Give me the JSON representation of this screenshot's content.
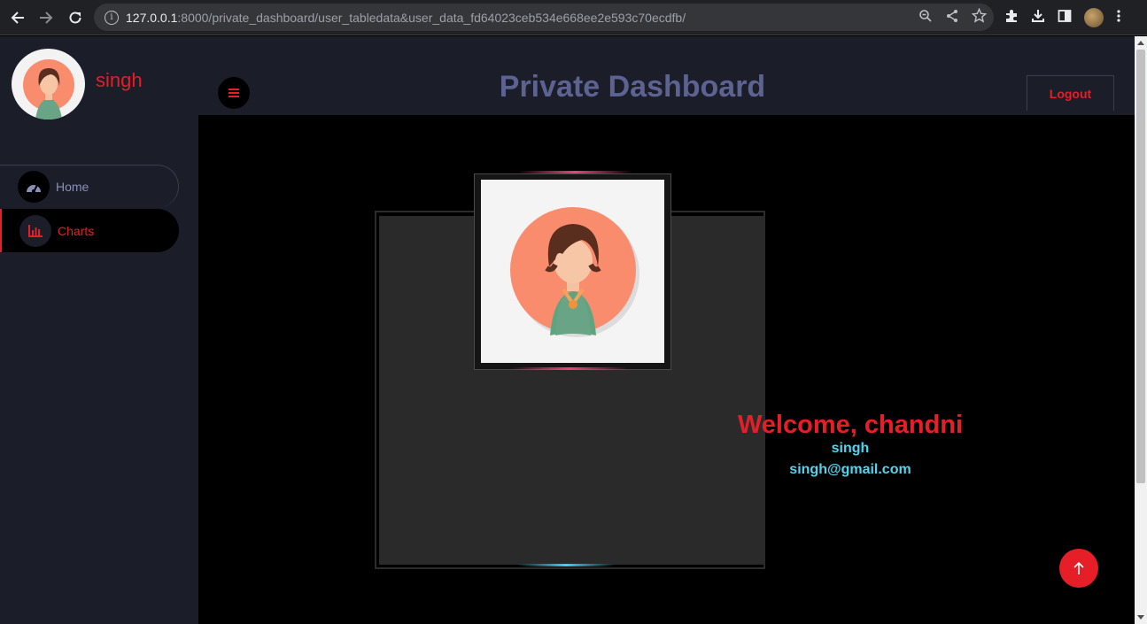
{
  "browser": {
    "url_host": "127.0.0.1",
    "url_rest": ":8000/private_dashboard/user_tabledata&user_data_fd64023ceb534e668ee2e593c70ecdfb/"
  },
  "sidebar": {
    "username": "singh",
    "items": [
      {
        "label": "Home",
        "icon": "dashboard-gauge-icon",
        "active": false
      },
      {
        "label": "Charts",
        "icon": "bar-chart-icon",
        "active": true
      }
    ]
  },
  "header": {
    "title": "Private Dashboard",
    "logout_label": "Logout"
  },
  "profile": {
    "welcome": "Welcome, chandni",
    "name": "singh",
    "email": "singh@gmail.com"
  },
  "colors": {
    "accent": "#e61e28",
    "cyan": "#4fd6ef",
    "title": "#5d6391",
    "panel": "#1b1d29"
  }
}
